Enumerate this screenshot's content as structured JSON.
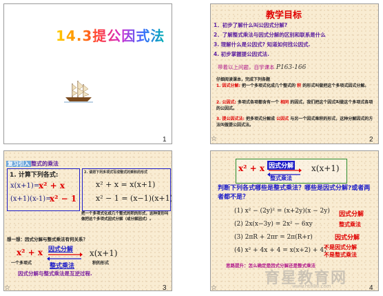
{
  "slides": [
    {
      "number": "1",
      "title": "14.3提公因式法"
    },
    {
      "number": "2",
      "heading": "教学目标",
      "goals": [
        "1．初步了解什么叫公因式分解?",
        "2．了解整式乘法与因式分解的区别和联系是什么",
        "3. 理解什么是公因式? 知道如何找公因式.",
        "4. 初步掌握提公因式法."
      ],
      "self_study_prefix": "带着以上问题，自学课本",
      "self_study_pages": "P163-166",
      "task_intro": "仔细阅读课本，完成下列各题",
      "defs": [
        {
          "label": "1. 因式分解:",
          "text": "把一个多项式化成几个整式的",
          "key": "积",
          "tail": "的形式叫做把这个多项式因式分解。"
        },
        {
          "label": "2. 公因式:",
          "text": "多项式各项都含有一个",
          "key": "相同",
          "tail": "的因式，我们把这个因式叫做这个多项式各项的公因式。"
        },
        {
          "label": "3. 提公因式法:",
          "text": "把多项式分解成",
          "key": "公因式",
          "tail": "与另一个因式乘积的形式，这种分解因式的方法叫做提公因式法。"
        }
      ]
    },
    {
      "number": "3",
      "title_prefix": "复习引入",
      "title": "整式的乘法",
      "calc_title": "1. 计算下列各式:",
      "calc_lines": [
        "x(x+1)=",
        "(x+1)(x-1)="
      ],
      "calc_answers": [
        "x² + x",
        "x² − 1"
      ],
      "right_title": "2. 请把下列多项式写成整式的乘积的形式",
      "right_lines": [
        "x² + x = x(x+1)",
        "x² − 1 = (x−1)(x+1)"
      ],
      "explain": "把一个多项式化成几个整式的积的形式，这种变形叫做把这个多项式因式分解（或分解因式）。",
      "think": "想一想：因式分解与整式乘法有何关系？",
      "arrow_top": "因式分解",
      "arrow_bottom": "整式乘法",
      "poly": "x² + x",
      "product": "x(x+1)",
      "label_left": "一个多项式",
      "label_right": "积的形式",
      "conclusion": "因式分解与整式乘法是互逆过程."
    },
    {
      "number": "4",
      "top_poly": "x² + x",
      "top_arrow_top": "因式分解",
      "top_arrow_bottom": "整式乘法",
      "top_product": "x(x+1)",
      "question": "判断下列各式哪些是整式乘法？哪些是因式分解?或者两者都不是？",
      "items": [
        {
          "expr": "(1) x² − (2y)² = (x+2y)(x − 2y)",
          "answer": "因式分解"
        },
        {
          "expr": "(2) 2x(x−3y) = 2x² − 6xy",
          "answer": "整式乘法"
        },
        {
          "expr": "(3) 2πR + 2πr = 2π(R+r)",
          "answer": "因式分解"
        },
        {
          "expr": "(4) x² + 4x + 4 = x(x+2) + 4；",
          "answer": "不是因式分解"
        }
      ],
      "extra_answer": "不是整式乘法",
      "footer": "思路提升：怎么确定是因式分解还是整式乘法",
      "watermark": "育星教育网",
      "watermark_url": "www.ht888.com"
    }
  ]
}
